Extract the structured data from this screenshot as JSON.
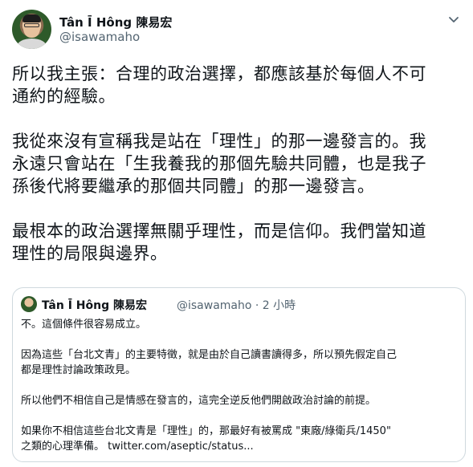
{
  "author": {
    "name": "Tân Ī Hông 陳易宏",
    "handle": "@isawamaho"
  },
  "tweet": {
    "paragraphs": [
      [
        "所以我主張：合理的政治選擇，都應該基於每個人不可",
        "通約的經驗。"
      ],
      [
        "我從來沒有宣稱我是站在「理性」的那一邊發言的。我",
        "永遠只會站在「生我養我的那個先驗共同體，也是我子",
        "孫後代將要繼承的那個共同體」的那一邊發言。"
      ],
      [
        "最根本的政治選擇無關乎理性，而是信仰。我們當知道",
        "理性的局限與邊界。"
      ]
    ]
  },
  "quoted_tweet": {
    "name": "Tân Ī Hông 陳易宏",
    "meta": "@isawamaho · 2 小時",
    "lines": [
      "不。這個條件很容易成立。",
      "因為這些「台北文青」的主要特徵，就是由於自己讀書讀得多，所以預先假定自己",
      "都是理性討論政策政見。",
      "所以他們不相信自己是情感在發言的，這完全逆反他們開啟政治討論的前提。",
      "如果你不相信這些台北文青是「理性」的，那最好有被罵成 \"東廠/綠衛兵/1450\"",
      "之類的心理準備。 twitter.com/aseptic/status..."
    ]
  },
  "icons": {
    "more": "chevron-down-icon"
  }
}
